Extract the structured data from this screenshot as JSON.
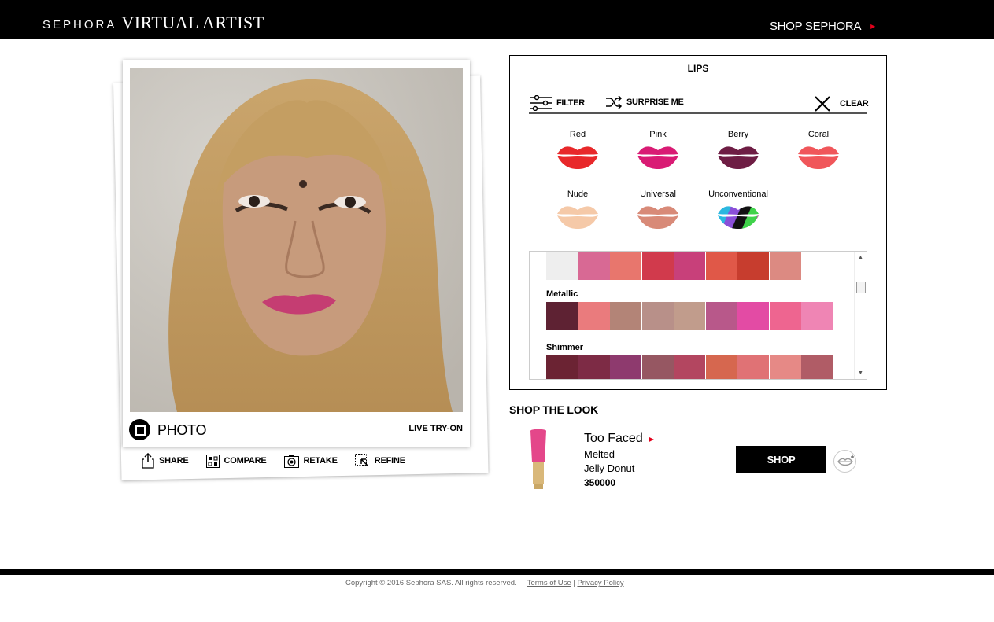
{
  "header": {
    "brand": "SEPHORA",
    "product": "VIRTUAL ARTIST",
    "shop_link": "SHOP SEPHORA"
  },
  "photo_card": {
    "mode_label": "PHOTO",
    "live_link": "LIVE TRY-ON",
    "actions": [
      {
        "label": "SHARE",
        "icon": "share-icon"
      },
      {
        "label": "COMPARE",
        "icon": "compare-icon"
      },
      {
        "label": "RETAKE",
        "icon": "retake-icon"
      },
      {
        "label": "REFINE",
        "icon": "refine-icon"
      }
    ]
  },
  "panel": {
    "title": "LIPS",
    "filter_label": "FILTER",
    "surprise_label": "SURPRISE ME",
    "clear_label": "CLEAR",
    "families": [
      {
        "label": "Red",
        "color": "#e8282a"
      },
      {
        "label": "Pink",
        "color": "#d91b74"
      },
      {
        "label": "Berry",
        "color": "#6e1d44"
      },
      {
        "label": "Coral",
        "color": "#f0565a"
      },
      {
        "label": "Nude",
        "color": "#f5c9a8"
      },
      {
        "label": "Universal",
        "color": "#d88a78"
      },
      {
        "label": "Unconventional",
        "color": "#8a4fd8"
      }
    ],
    "swatch_groups": [
      {
        "label": "",
        "colors": [
          "#eeeeee",
          "#d86994",
          "#e8766d",
          "#d13a4c",
          "#c8407a",
          "#e05848",
          "#c73d2e",
          "#dc8a82"
        ]
      },
      {
        "label": "Metallic",
        "colors": [
          "#5e2233",
          "#ea7b7d",
          "#b38477",
          "#b89089",
          "#c19c8c",
          "#b8588a",
          "#e34ba4",
          "#ee6590",
          "#ef85b4"
        ]
      },
      {
        "label": "Shimmer",
        "colors": [
          "#6b2333",
          "#7d2b45",
          "#8e3a6e",
          "#965762",
          "#b34660",
          "#d6674f",
          "#e07275",
          "#e68986",
          "#b05c66"
        ]
      }
    ]
  },
  "shop_the_look": {
    "title": "SHOP THE LOOK",
    "brand": "Too Faced",
    "product_line1": "Melted",
    "product_line2": "Jelly Donut",
    "price": "350000",
    "shop_button": "SHOP",
    "product_color": "#e4478a"
  },
  "footer": {
    "copyright": "Copyright © 2016 Sephora SAS. All rights reserved.",
    "terms": "Terms of Use",
    "separator": "|",
    "privacy": "Privacy Policy"
  }
}
